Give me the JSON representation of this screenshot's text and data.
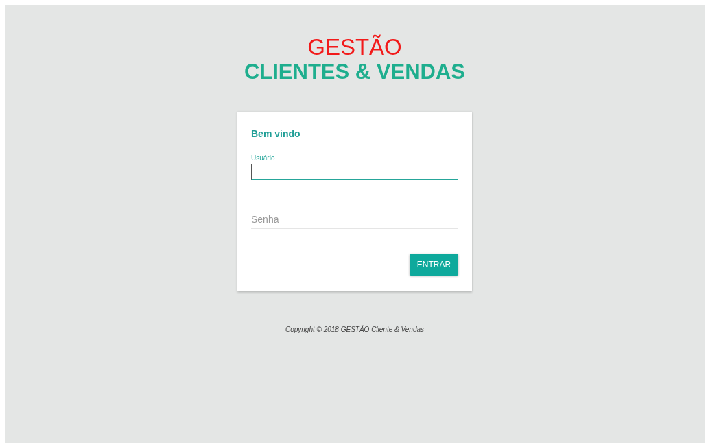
{
  "brand": {
    "line_1": "GESTÃO",
    "line_2": "CLIENTES & VENDAS"
  },
  "login_card": {
    "title": "Bem vindo",
    "fields": [
      {
        "label": "Usuário",
        "focused": true
      },
      {
        "placeholder": "Senha",
        "focused": false
      }
    ],
    "button": "ENTRAR"
  },
  "footer": "Copyright © 2018 GESTÃO Cliente & Vendas"
}
